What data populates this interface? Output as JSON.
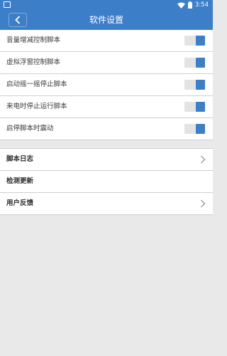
{
  "status_bar": {
    "time": "3:54",
    "icons": [
      "square-icon",
      "wifi-icon",
      "battery-icon"
    ]
  },
  "header": {
    "title": "软件设置",
    "back_icon": "chevron-left-icon"
  },
  "toggles": [
    {
      "label": "音量增减控制脚本",
      "on": true
    },
    {
      "label": "虚拟浮窗控制脚本",
      "on": true
    },
    {
      "label": "启动摇一摇停止脚本",
      "on": true
    },
    {
      "label": "来电时停止运行脚本",
      "on": true
    },
    {
      "label": "启停脚本时震动",
      "on": true
    }
  ],
  "menu": [
    {
      "label": "脚本日志",
      "chevron": true
    },
    {
      "label": "检测更新",
      "chevron": false
    },
    {
      "label": "用户反馈",
      "chevron": true
    }
  ],
  "colors": {
    "accent": "#3d7ec9",
    "background": "#e9e9e9",
    "row_background": "#ffffff",
    "divider": "#cfcfcf",
    "switch_track": "#e3e3e3"
  }
}
